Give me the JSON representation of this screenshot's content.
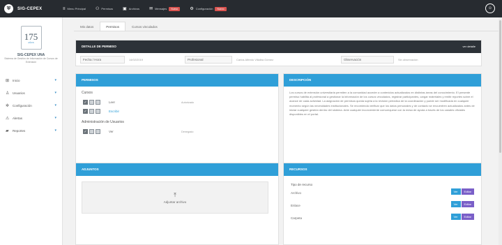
{
  "app": {
    "brand": "SIG-CEPEX",
    "brand_icon": "shield-icon"
  },
  "topnav": [
    {
      "icon": "menu-icon",
      "label": "Menu Principal"
    },
    {
      "icon": "users-icon",
      "label": "Permisos"
    },
    {
      "icon": "image-icon",
      "label": "Archivos"
    },
    {
      "icon": "mail-icon",
      "label": "Mensajes",
      "badge": "Nuevo"
    },
    {
      "icon": "gear-icon",
      "label": "Configuración",
      "badge": "Nuevo"
    }
  ],
  "sidebar": {
    "logo_number": "175",
    "logo_caption": "AÑOS",
    "title": "SIG-CEPEX UNA",
    "subtitle": "Sistema de Gestión de Información de Cursos de Extensión",
    "items": [
      {
        "icon": "grid-icon",
        "label": "Inicio"
      },
      {
        "icon": "user-icon",
        "label": "Usuarios"
      },
      {
        "icon": "cog-icon",
        "label": "Configuración"
      },
      {
        "icon": "warning-icon",
        "label": "Alertas"
      },
      {
        "icon": "folder-icon",
        "label": "Reportes"
      }
    ]
  },
  "tabs": [
    "Mis datos",
    "Permisos",
    "Cursos vinculados"
  ],
  "detail": {
    "header": "DETALLE DE PERMISO",
    "header_right": "ver detalle",
    "fields": [
      {
        "label": "Fecha / Hora",
        "value": "14/02/2019"
      },
      {
        "label": "Profesional",
        "value": "Carlos Alfredo Villalba Gómez"
      },
      {
        "label": "Observación",
        "value": "Sin observación"
      }
    ]
  },
  "permissions": {
    "header": "PERMISOS",
    "groups": [
      {
        "title": "Cursos",
        "rows": [
          {
            "name": "Leer",
            "value": "Autorizado",
            "link": false
          },
          {
            "name": "Escribir",
            "value": "",
            "link": true
          }
        ]
      },
      {
        "title": "Administración de Usuarios",
        "rows": [
          {
            "name": "Ver",
            "value": "Denegado",
            "link": false
          }
        ]
      }
    ]
  },
  "description": {
    "header": "DESCRIPCIÓN",
    "text": "Los cursos de extensión universitaria permiten a la comunidad acceder a contenidos actualizados en distintas áreas del conocimiento. El presente permiso habilita al profesional a gestionar la información de los cursos vinculados, registrar participantes, cargar materiales y emitir reportes sobre el avance de cada actividad. La asignación de permisos queda sujeta a la revisión periódica de la coordinación y puede ser modificada en cualquier momento según las necesidades institucionales. Se recomienda verificar que los datos personales y de contacto se encuentren actualizados antes de iniciar cualquier gestión dentro del sistema. Ante cualquier inconveniente comuníquese con la mesa de ayuda a través de los canales oficiales disponibles en el portal."
  },
  "attachments": {
    "header": "ADJUNTOS",
    "upload_label": "Adjuntar archivo"
  },
  "resources": {
    "header": "RECURSOS",
    "subheader": "Tipo de recurso",
    "rows": [
      {
        "name": "Archivo",
        "btn1": "Ver",
        "btn2": "Editar"
      },
      {
        "name": "Enlace",
        "btn1": "Ver",
        "btn2": "Editar"
      },
      {
        "name": "Carpeta",
        "btn1": "Ver",
        "btn2": "Editar"
      }
    ]
  }
}
